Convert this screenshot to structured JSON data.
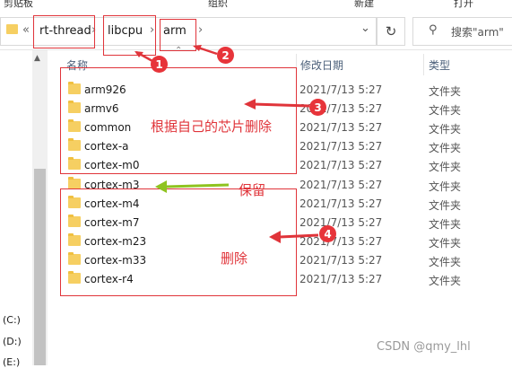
{
  "ribbon": {
    "clipboard": "剪贴板",
    "organize": "组织",
    "new": "新建",
    "open": "打开"
  },
  "address": {
    "overflow": "«",
    "crumbs": [
      "rt-thread",
      "libcpu",
      "arm"
    ],
    "sep": "›",
    "dropdown": "⌄"
  },
  "search": {
    "placeholder": "搜索\"arm\""
  },
  "columns": {
    "name": "名称",
    "modified": "修改日期",
    "type": "类型"
  },
  "rows": [
    {
      "name": "arm926",
      "modified": "2021/7/13 5:27",
      "type": "文件夹"
    },
    {
      "name": "armv6",
      "modified": "2021/7/13 5:27",
      "type": "文件夹"
    },
    {
      "name": "common",
      "modified": "2021/7/13 5:27",
      "type": "文件夹"
    },
    {
      "name": "cortex-a",
      "modified": "2021/7/13 5:27",
      "type": "文件夹"
    },
    {
      "name": "cortex-m0",
      "modified": "2021/7/13 5:27",
      "type": "文件夹"
    },
    {
      "name": "cortex-m3",
      "modified": "2021/7/13 5:27",
      "type": "文件夹"
    },
    {
      "name": "cortex-m4",
      "modified": "2021/7/13 5:27",
      "type": "文件夹"
    },
    {
      "name": "cortex-m7",
      "modified": "2021/7/13 5:27",
      "type": "文件夹"
    },
    {
      "name": "cortex-m23",
      "modified": "2021/7/13 5:27",
      "type": "文件夹"
    },
    {
      "name": "cortex-m33",
      "modified": "2021/7/13 5:27",
      "type": "文件夹"
    },
    {
      "name": "cortex-r4",
      "modified": "2021/7/13 5:27",
      "type": "文件夹"
    }
  ],
  "drives": [
    "(C:)",
    "(D:)",
    "(E:)"
  ],
  "annotations": {
    "badges": [
      "1",
      "2",
      "3",
      "4"
    ],
    "delete_by_chip": "根据自己的芯片删除",
    "keep": "保留",
    "delete": "删除",
    "colors": {
      "red": "#e0343a",
      "green": "#8fc31f"
    }
  },
  "watermark": "CSDN @qmy_lhl"
}
